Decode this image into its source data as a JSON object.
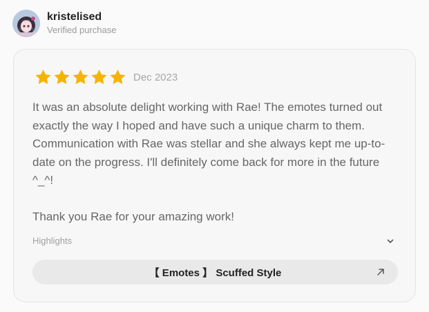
{
  "reviewer": {
    "username": "kristelised",
    "badge": "Verified purchase",
    "avatar_icon": "avatar-portrait"
  },
  "review": {
    "rating": 5,
    "rating_max": 5,
    "star_color": "#f5b400",
    "date": "Dec 2023",
    "body": "It was an absolute delight working with Rae! The emotes turned out exactly the way I hoped and have such a unique charm to them. Communication with Rae was stellar and she always kept me up-to-date on the progress. I'll definitely come back for more in the future ^_^!\n\nThank you Rae for your amazing work!"
  },
  "highlights": {
    "label": "Highlights",
    "toggle_icon": "chevron-down-icon"
  },
  "tag": {
    "label": "【 Emotes 】 Scuffed Style",
    "icon": "arrow-up-right-icon"
  }
}
